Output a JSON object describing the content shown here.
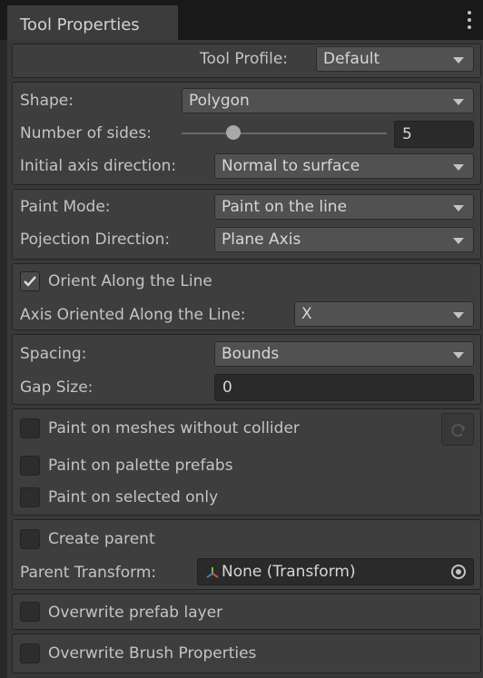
{
  "tab": {
    "title": "Tool Properties"
  },
  "profile": {
    "label": "Tool Profile:",
    "value": "Default"
  },
  "shape": {
    "shape_label": "Shape:",
    "shape_value": "Polygon",
    "sides_label": "Number of sides:",
    "sides_value": "5",
    "sides_slider_fraction": 0.25,
    "axis_label": "Initial axis direction:",
    "axis_value": "Normal to surface"
  },
  "paint": {
    "mode_label": "Paint Mode:",
    "mode_value": "Paint on the line",
    "projection_label": "Pojection Direction:",
    "projection_value": "Plane Axis"
  },
  "orient": {
    "checkbox_label": "Orient Along the Line",
    "checked": true,
    "axis_label": "Axis Oriented Along the Line:",
    "axis_value": "X"
  },
  "spacing": {
    "label": "Spacing:",
    "value": "Bounds",
    "gap_label": "Gap Size:",
    "gap_value": "0"
  },
  "paint_targets": {
    "meshes_label": "Paint on meshes without collider",
    "palette_label": "Paint on palette prefabs",
    "selected_label": "Paint on selected only"
  },
  "parent": {
    "create_label": "Create parent",
    "transform_label": "Parent Transform:",
    "transform_value": "None (Transform)"
  },
  "layer": {
    "label": "Overwrite prefab layer"
  },
  "brush": {
    "label": "Overwrite Brush Properties"
  },
  "icons": {
    "tab_menu": "kebab-icon",
    "refresh": "refresh-icon",
    "transform": "transform-axes-icon",
    "picker": "object-picker-icon",
    "check": "checkmark-icon"
  }
}
